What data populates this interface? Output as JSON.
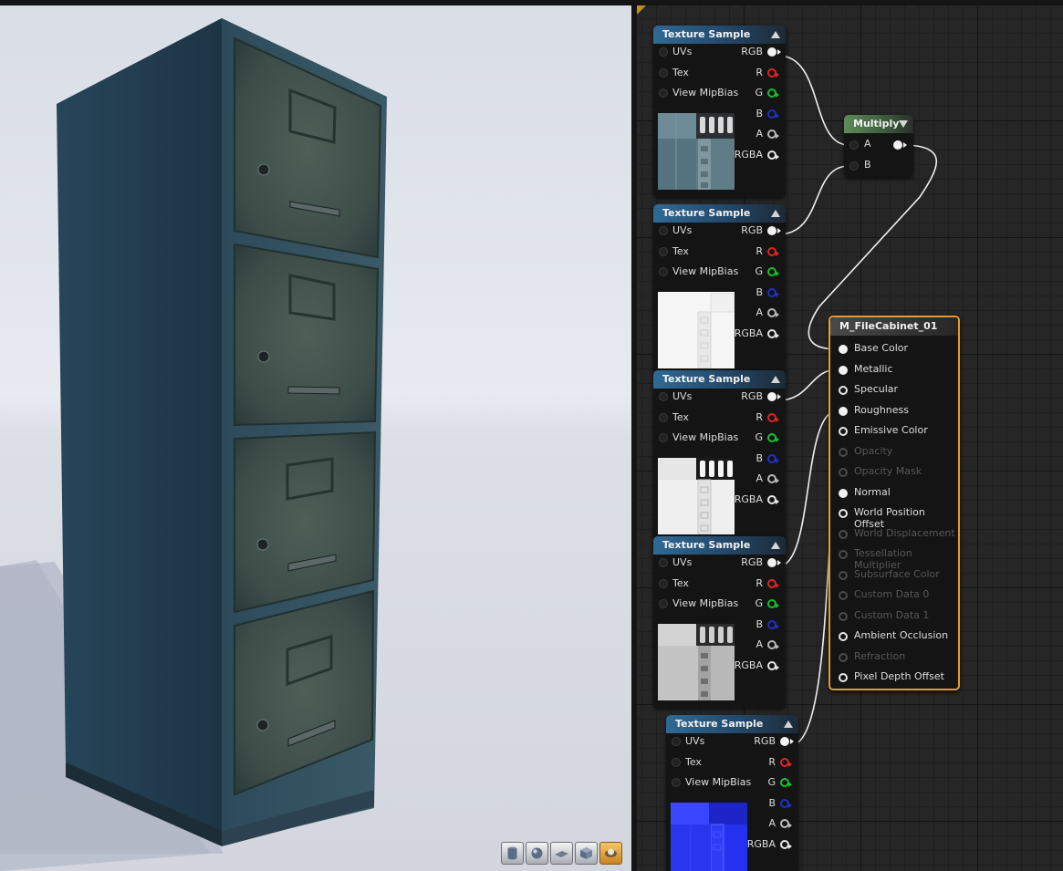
{
  "viewport": {
    "toolbar": [
      {
        "name": "cylinder-preview-icon"
      },
      {
        "name": "sphere-preview-icon"
      },
      {
        "name": "plane-preview-icon"
      },
      {
        "name": "cube-preview-icon"
      },
      {
        "name": "custom-mesh-preview-icon",
        "active": true
      }
    ]
  },
  "graph": {
    "texture_nodes": [
      {
        "title": "Texture Sample",
        "inputs": [
          "UVs",
          "Tex",
          "View MipBias"
        ],
        "outputs": [
          "RGB",
          "R",
          "G",
          "B",
          "A",
          "RGBA"
        ],
        "preview": "base-color-texture"
      },
      {
        "title": "Texture Sample",
        "inputs": [
          "UVs",
          "Tex",
          "View MipBias"
        ],
        "outputs": [
          "RGB",
          "R",
          "G",
          "B",
          "A",
          "RGBA"
        ],
        "preview": "metallic-mask-texture"
      },
      {
        "title": "Texture Sample",
        "inputs": [
          "UVs",
          "Tex",
          "View MipBias"
        ],
        "outputs": [
          "RGB",
          "R",
          "G",
          "B",
          "A",
          "RGBA"
        ],
        "preview": "metallic-texture"
      },
      {
        "title": "Texture Sample",
        "inputs": [
          "UVs",
          "Tex",
          "View MipBias"
        ],
        "outputs": [
          "RGB",
          "R",
          "G",
          "B",
          "A",
          "RGBA"
        ],
        "preview": "roughness-texture"
      },
      {
        "title": "Texture Sample",
        "inputs": [
          "UVs",
          "Tex",
          "View MipBias"
        ],
        "outputs": [
          "RGB",
          "R",
          "G",
          "B",
          "A",
          "RGBA"
        ],
        "preview": "normal-map-texture"
      }
    ],
    "multiply_node": {
      "title": "Multiply",
      "inputs": [
        "A",
        "B"
      ]
    },
    "material_node": {
      "title": "M_FileCabinet_01",
      "inputs": [
        {
          "label": "Base Color",
          "state": "connected"
        },
        {
          "label": "Metallic",
          "state": "connected"
        },
        {
          "label": "Specular",
          "state": "enabled"
        },
        {
          "label": "Roughness",
          "state": "connected"
        },
        {
          "label": "Emissive Color",
          "state": "enabled"
        },
        {
          "label": "Opacity",
          "state": "disabled"
        },
        {
          "label": "Opacity Mask",
          "state": "disabled"
        },
        {
          "label": "Normal",
          "state": "connected"
        },
        {
          "label": "World Position Offset",
          "state": "enabled"
        },
        {
          "label": "World Displacement",
          "state": "disabled"
        },
        {
          "label": "Tessellation Multiplier",
          "state": "disabled"
        },
        {
          "label": "Subsurface Color",
          "state": "disabled"
        },
        {
          "label": "Custom Data 0",
          "state": "disabled"
        },
        {
          "label": "Custom Data 1",
          "state": "disabled"
        },
        {
          "label": "Ambient Occlusion",
          "state": "enabled"
        },
        {
          "label": "Refraction",
          "state": "disabled"
        },
        {
          "label": "Pixel Depth Offset",
          "state": "enabled"
        }
      ]
    }
  },
  "colors": {
    "material_border": "#e99a2d",
    "texture_header": "#2f6a95",
    "multiply_header": "#5f8c5a",
    "pin_r": "#e02424",
    "pin_g": "#17c02a",
    "pin_b": "#1d31c8"
  }
}
